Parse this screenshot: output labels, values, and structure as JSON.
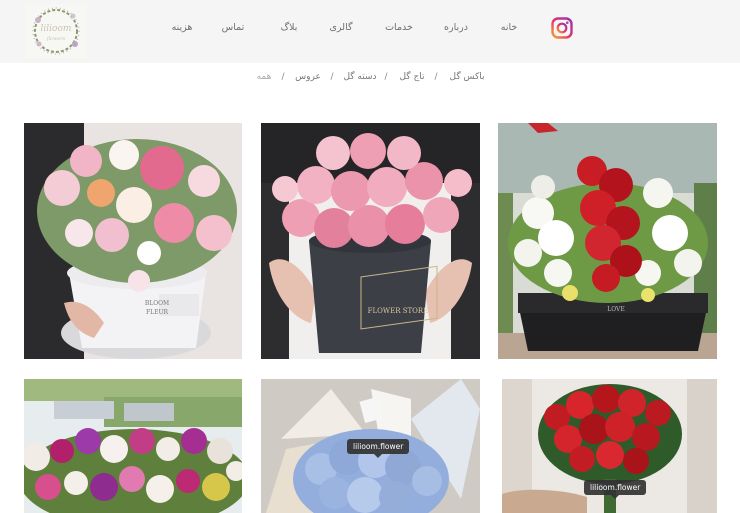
{
  "colors": {
    "header_bg": "#f5f5f5",
    "nav_text": "#6f6f6f",
    "instagram": "#e1306c"
  },
  "header": {
    "logo_text": "lilioom",
    "logo_sub": "flowers",
    "logo_icon": "floral-wreath-logo",
    "instagram_icon": "instagram-icon",
    "nav": {
      "home": "خانه",
      "about": "درباره",
      "services": "خدمات",
      "gallery": "گالری",
      "blog": "بلاگ",
      "contact": "تماس",
      "cost": "هزینه"
    }
  },
  "filters": {
    "box": "باکس گل",
    "crown": "تاج گل",
    "bouquet": "دسته گل",
    "bride": "عروس",
    "all": "همه",
    "separator": "/"
  },
  "gallery": {
    "items": [
      {
        "subject": "pink and white roses in a white hat box",
        "box_text": "BLOOM",
        "box_text_2": "FLEUR"
      },
      {
        "subject": "pink roses in a black round box",
        "box_text": "FLOWER STORE"
      },
      {
        "subject": "red and white flowers in a black box",
        "box_text": "LOVE"
      },
      {
        "subject": "mixed flower crown arrangement"
      },
      {
        "subject": "blue hydrangea bouquet",
        "box_text": "lilioom.flower"
      },
      {
        "subject": "red rose bouquet",
        "box_text": "lilioom.flower"
      }
    ]
  }
}
